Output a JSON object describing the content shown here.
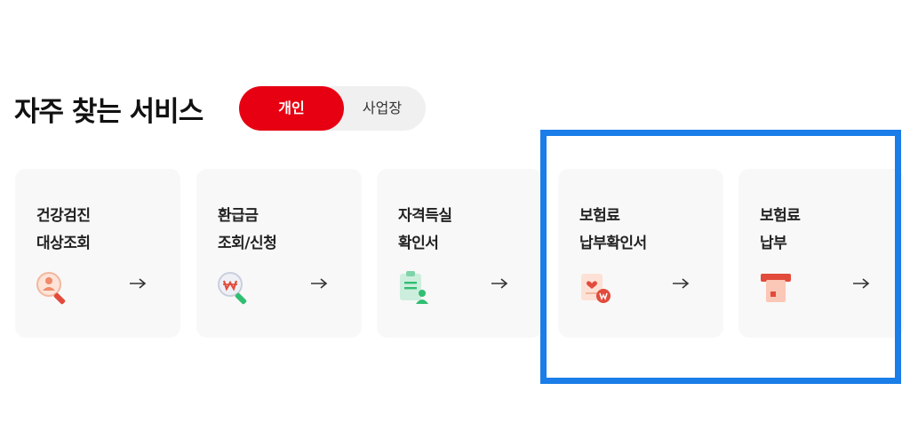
{
  "section": {
    "title": "자주 찾는 서비스"
  },
  "toggle": {
    "active_label": "개인",
    "inactive_label": "사업장"
  },
  "cards": [
    {
      "line1": "건강검진",
      "line2": "대상조회",
      "icon": "magnifier-person-icon",
      "arrow": "→"
    },
    {
      "line1": "환급금",
      "line2": "조회/신청",
      "icon": "magnifier-won-icon",
      "arrow": "→"
    },
    {
      "line1": "자격득실",
      "line2": "확인서",
      "icon": "document-person-icon",
      "arrow": "→"
    },
    {
      "line1": "보험료",
      "line2": "납부확인서",
      "icon": "document-won-icon",
      "arrow": "→"
    },
    {
      "line1": "보험료",
      "line2": "납부",
      "icon": "card-payment-icon",
      "arrow": "→"
    }
  ],
  "colors": {
    "accent_red": "#e60012",
    "highlight_blue": "#1a7de8",
    "icon_green": "#2fbf71"
  }
}
